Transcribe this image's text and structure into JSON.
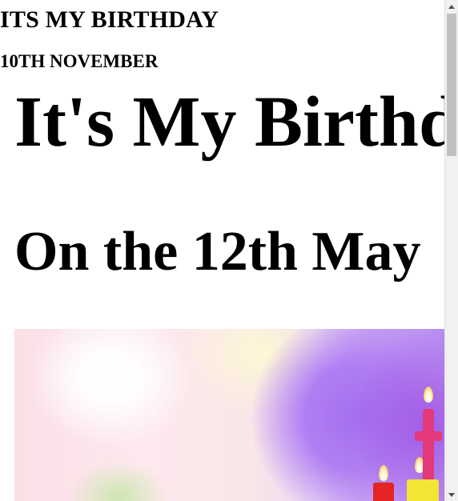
{
  "page": {
    "small_title": "ITS MY BIRTHDAY",
    "small_date": "10TH NOVEMBER",
    "big_title": "It's My Birthday",
    "date_heading": "On the 12th May"
  },
  "image": {
    "description_icon": "birthday-balloons-candles-photo"
  },
  "scrollbar": {
    "up_icon": "scroll-up-arrow-icon",
    "down_icon": "scroll-down-arrow-icon"
  },
  "colors": {
    "text": "#000000",
    "background": "#ffffff",
    "scrollbar_track": "#f1f1f1",
    "scrollbar_thumb": "#c1c1c1"
  }
}
